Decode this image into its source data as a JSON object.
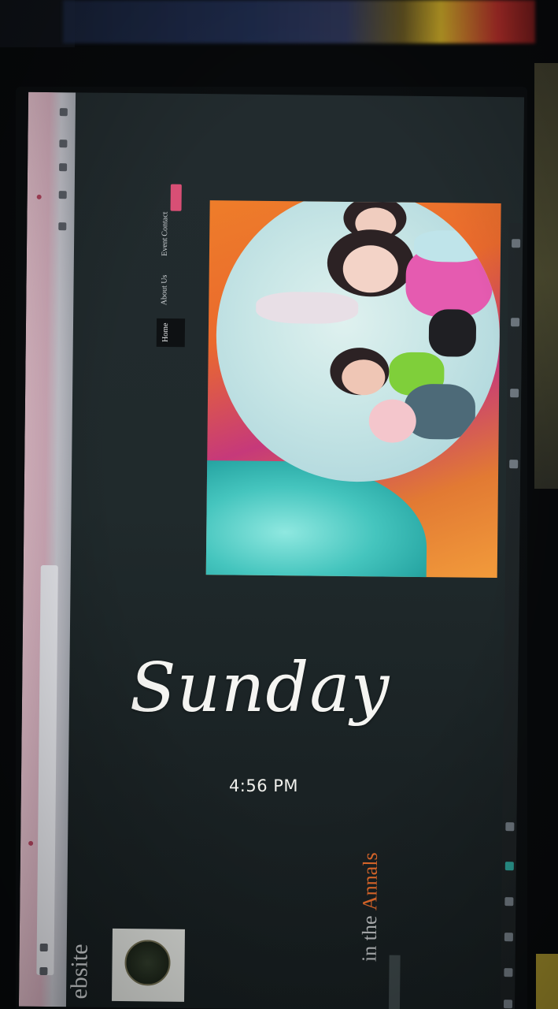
{
  "overlay": {
    "day": "Sunday",
    "time": "4:56 PM"
  },
  "photo": {
    "subject": "Photo of a computer monitor displaying a website, taken at an angle (screen content rotated)",
    "site_nav": [
      "Home",
      "About Us",
      "Event",
      "Contact"
    ],
    "site_heading": "ebsite",
    "site_subheading_prefix": "in the ",
    "site_subheading_accent": "Annals",
    "colors": {
      "accent_orange": "#e26a2b",
      "accent_pink": "#d84f75",
      "teal": "#2aa9a6"
    }
  }
}
